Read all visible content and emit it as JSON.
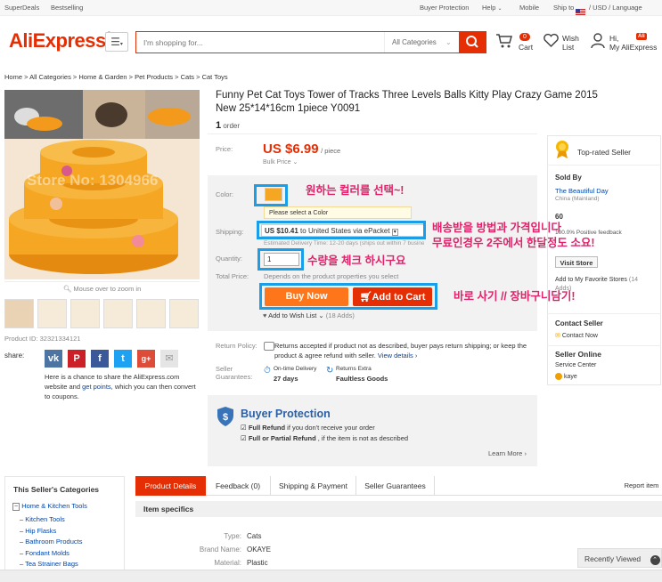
{
  "colors": {
    "brand": "#e62e04",
    "accent_orange": "#ff7519",
    "link": "#0045aa",
    "annotation_pink": "#e0226a",
    "annotation_blue": "#1a9ee8"
  },
  "topbar": {
    "left_links": [
      "SuperDeals",
      "Bestselling"
    ],
    "right_links": [
      "Buyer Protection",
      "Help",
      "Mobile",
      "Ship to",
      "/ USD / Language"
    ]
  },
  "header": {
    "logo": "AliExpress",
    "logo_tm": "®",
    "menu_icon": "hamburger-icon",
    "search": {
      "placeholder": "I'm shopping for...",
      "category": "All Categories"
    },
    "cart": {
      "count": "0",
      "label": "Cart"
    },
    "wish": {
      "line1": "Wish",
      "line2": "List"
    },
    "account": {
      "line1": "Hi,",
      "line2": "My AliExpress",
      "badge": "Ali"
    }
  },
  "breadcrumb": "Home > All Categories > Home & Garden > Pet Products > Cats > Cat Toys",
  "gallery": {
    "watermark": "Store No: 1304966",
    "zoom_hint": "Mouse over to zoom in",
    "product_id": "Product ID: 32321334121"
  },
  "share": {
    "label": "share:",
    "text1": "Here is a chance to share the AliExpress.com",
    "text2_pre": "website and ",
    "text2_link": "get points",
    "text2_post": ", which you can then convert",
    "text3": "to coupons."
  },
  "product": {
    "title": "Funny Pet Cat Toys Tower of Tracks Three Levels Balls Kitty Play Crazy Game 2015 New 25*14*16cm 1piece Y0091",
    "orders_count": "1",
    "orders_label": "order",
    "price_label": "Price:",
    "price": "US $6.99",
    "price_unit": "/ piece",
    "bulk_price": "Bulk Price",
    "color_label": "Color:",
    "color_prompt": "Please select a Color",
    "shipping_label": "Shipping:",
    "shipping_price": "US $10.41",
    "shipping_to": "to  United States via ePacket",
    "shipping_note": "Estimated Delivery Time: 12-20 days (ships out within 7 business days)",
    "quantity_label": "Quantity:",
    "quantity_value": "1",
    "total_label": "Total Price:",
    "total_text": "Depends on the product properties you select",
    "buy_now": "Buy Now",
    "add_to_cart": "Add to Cart",
    "wish_list": "Add to Wish List",
    "wish_count": "(18 Adds)",
    "return_label": "Return Policy:",
    "return_text": "Returns accepted if product not as described, buyer pays return shipping; or keep the product & agree refund with seller.",
    "view_details": "View details",
    "guarantee_label1": "Seller",
    "guarantee_label2": "Guarantees:",
    "on_time_title": "On-time Delivery",
    "on_time_days": "27 days",
    "returns_title": "Returns Extra",
    "returns_sub": "Faultless Goods",
    "protection_title": "Buyer Protection",
    "protection_1_bold": "Full Refund",
    "protection_1_rest": " if you don't receive your order",
    "protection_2_bold": "Full or Partial Refund",
    "protection_2_rest": " , if the item is not as described",
    "learn_more": "Learn More"
  },
  "annotations": {
    "color": "원하는 컬러를 선택~!",
    "shipping_1": "배송받을 방법과 가격입니다",
    "shipping_2": "무료인경우 2주에서 한달정도 소요!",
    "quantity": "수량을 체크 하시구요",
    "buy": "바로 사기 // 장바구니담기!"
  },
  "seller": {
    "top_rated": "Top-rated Seller",
    "sold_by": "Sold By",
    "store_name": "The Beautiful Day",
    "store_loc": "China (Mainland)",
    "score": "60",
    "feedback_pre": "100.0%",
    "feedback": "Positive feedback",
    "visit_store": "Visit Store",
    "add_favorite": "Add to My Favorite Stores",
    "favorite_count": "(14",
    "favorite_count2": "Adds)",
    "contact_title": "Contact Seller",
    "contact_now": "Contact Now",
    "online_title": "Seller Online",
    "service_center": "Service Center",
    "agent": "kaye"
  },
  "categories": {
    "title": "This Seller's Categories",
    "root": "Home & Kitchen Tools",
    "items": [
      "Kitchen Tools",
      "Hip Flasks",
      "Bathroom Products",
      "Fondant Molds",
      "Tea Strainer Bags"
    ]
  },
  "tabs": {
    "items": [
      "Product Details",
      "Feedback (0)",
      "Shipping & Payment",
      "Seller Guarantees"
    ],
    "report": "Report item"
  },
  "specifics": {
    "title": "Item specifics",
    "rows": [
      {
        "k": "Type:",
        "v": "Cats"
      },
      {
        "k": "Brand Name:",
        "v": "OKAYE"
      },
      {
        "k": "Material:",
        "v": "Plastic"
      }
    ]
  },
  "recently_viewed": "Recently Viewed"
}
